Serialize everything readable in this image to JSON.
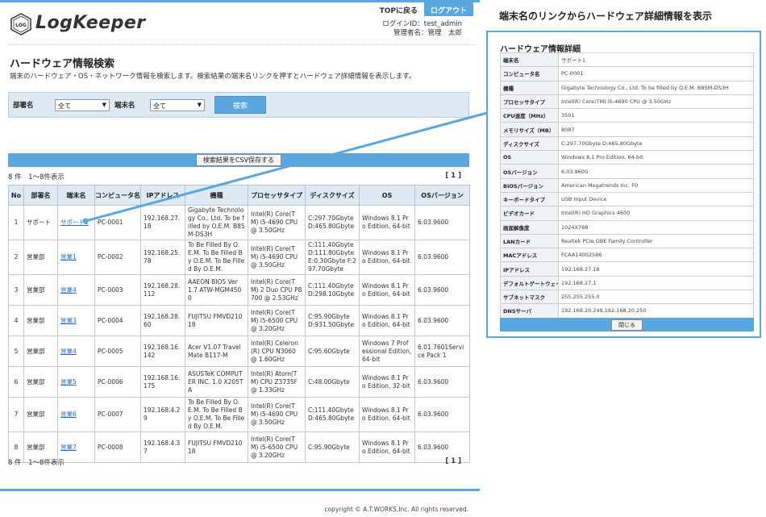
{
  "brand": {
    "name": "LogKeeper",
    "seal_text": "LOG"
  },
  "nav": {
    "top_link": "TOPに戻る",
    "logout": "ログアウト"
  },
  "login": {
    "id_line": "ログインID：test_admin",
    "admin_line": "管理者名：管理　太郎"
  },
  "page": {
    "title": "ハードウェア情報検索",
    "description": "端末のハードウェア・OS・ネットワーク情報を検索します。検索結果の端末名リンクを押すとハードウェア詳細情報を表示します。"
  },
  "search": {
    "dept_label": "部署名",
    "dept_value": "全て",
    "terminal_label": "端末名",
    "terminal_value": "全て",
    "button": "検索"
  },
  "csv_button": "検索結果をCSV保存する",
  "result_count": "8 件　1～8件表示",
  "pager": "[ 1 ]",
  "table": {
    "headers": [
      "No",
      "部署名",
      "端末名",
      "コンピュータ名",
      "IPアドレス",
      "機種",
      "プロセッサタイプ",
      "ディスクサイズ",
      "OS",
      "OSバージョン"
    ],
    "rows": [
      [
        "1",
        "サポート",
        "サポート1",
        "PC-0001",
        "192.168.27.18",
        "Gigabyte Technology Co., Ltd. To be filled by O.E.M. B85M-DS3H",
        "Intel(R) Core(TM) i5-4690 CPU @ 3.50GHz",
        "C:297.70Gbyte D:465.80Gbyte",
        "Windows 8.1 Pro Edition, 64-bit",
        "6.03.9600"
      ],
      [
        "2",
        "営業部",
        "営業1",
        "PC-0002",
        "192.168.25.78",
        "To Be Filled By O.E.M. To Be Filled By O.E.M. To Be Filled By O.E.M.",
        "Intel(R) Core(TM) i5-4690 CPU @ 3.50GHz",
        "C:111.40Gbyte D:111.80Gbyte E:0.30Gbyte F:297.70Gbyte",
        "Windows 8.1 Pro Edition, 64-bit",
        "6.03.9600"
      ],
      [
        "3",
        "営業部",
        "営業4",
        "PC-0003",
        "192.168.28.112",
        "AAEON BIOS Ver 1.7 ATW-MGM4500",
        "Intel(R) Core(TM) 2 Duo CPU P8700 @ 2.53GHz",
        "C:111.40Gbyte D:298.10Gbyte",
        "Windows 8.1 Pro Edition, 64-bit",
        "6.03.9600"
      ],
      [
        "4",
        "営業部",
        "営業3",
        "PC-0004",
        "192.168.28.60",
        "FUJITSU FMVD21018",
        "Intel(R) Core(TM) i5-6500 CPU @ 3.20GHz",
        "C:95.90Gbyte D:931.50Gbyte",
        "Windows 8.1 Pro Edition, 64-bit",
        "6.03.9600"
      ],
      [
        "5",
        "営業部",
        "営業4",
        "PC-0005",
        "192.168.16.142",
        "Acer V1.07 TravelMate B117-M",
        "Intel(R) Celeron(R) CPU N3060 @ 1.60GHz",
        "C:95.60Gbyte",
        "Windows 7 Professional Edition, 64-bit",
        "6.01.7601Service Pack 1"
      ],
      [
        "6",
        "営業部",
        "営業5",
        "PC-0006",
        "192.168.16.175",
        "ASUSTeK COMPUTER INC. 1.0 X205TA",
        "Intel(R) Atom(TM) CPU Z3735F @ 1.33GHz",
        "C:48.00Gbyte",
        "Windows 8.1 Pro Edition, 32-bit",
        "6.03.9600"
      ],
      [
        "7",
        "営業部",
        "営業6",
        "PC-0007",
        "192.168.4.29",
        "To Be Filled By O.E.M. To Be Filled By O.E.M. To Be Filled By O.E.M.",
        "Intel(R) Core(TM) i5-4690 CPU @ 3.50GHz",
        "C:111.40Gbyte D:465.80Gbyte",
        "Windows 8.1 Pro Edition, 64-bit",
        "6.03.9600"
      ],
      [
        "8",
        "営業部",
        "営業7",
        "PC-0008",
        "192.168.4.37",
        "FUJITSU FMVD21018",
        "Intel(R) Core(TM) i5-6500 CPU @ 3.20GHz",
        "C:95.90Gbyte",
        "Windows 8.1 Pro Edition, 64-bit",
        "6.03.9600"
      ]
    ]
  },
  "callout": {
    "title": "端末名のリンクからハードウェア詳細情報を表示"
  },
  "detail": {
    "title": "ハードウェア情報詳細",
    "rows": [
      [
        "端末名",
        "サポート1"
      ],
      [
        "コンピュータ名",
        "PC-0001"
      ],
      [
        "機種",
        "Gigabyte Technology Co., Ltd. To be filled by O.E.M. B85M-DS3H"
      ],
      [
        "プロセッサタイプ",
        "Intel(R) Core(TM) i5-4690 CPU @ 3.50GHz"
      ],
      [
        "CPU速度（MHz）",
        "3501"
      ],
      [
        "メモリサイズ（MB）",
        "8087"
      ],
      [
        "ディスクサイズ",
        "C:297.70Gbyte D:465.80Gbyte"
      ],
      [
        "OS",
        "Windows 8.1 Pro Edition, 64-bit"
      ],
      [
        "OSバージョン",
        "6.03.9600"
      ],
      [
        "BIOSバージョン",
        "American Megatrends Inc. F0"
      ],
      [
        "キーボードタイプ",
        "USB Input Device"
      ],
      [
        "ビデオカード",
        "Intel(R) HD Graphics 4600"
      ],
      [
        "画面解像度",
        "1024X768"
      ],
      [
        "LANカード",
        "Realtek PCIe GBE Family Controller"
      ],
      [
        "MACアドレス",
        "FCAA14002586"
      ],
      [
        "IPアドレス",
        "192.168.27.18"
      ],
      [
        "デフォルトゲートウェイ",
        "192.168.27.1"
      ],
      [
        "サブネットマスク",
        "255.255.255.0"
      ],
      [
        "DNSサーバ",
        "192.168.20.249,192.168.20.250"
      ]
    ],
    "close_button": "閉じる"
  },
  "footer": {
    "copyright": "copyright © A.T.WORKS,Inc. All rights reserved."
  },
  "colors": {
    "accent": "#5aa7e0",
    "header_bg": "#dde9f3",
    "link": "#2a6fc7"
  }
}
